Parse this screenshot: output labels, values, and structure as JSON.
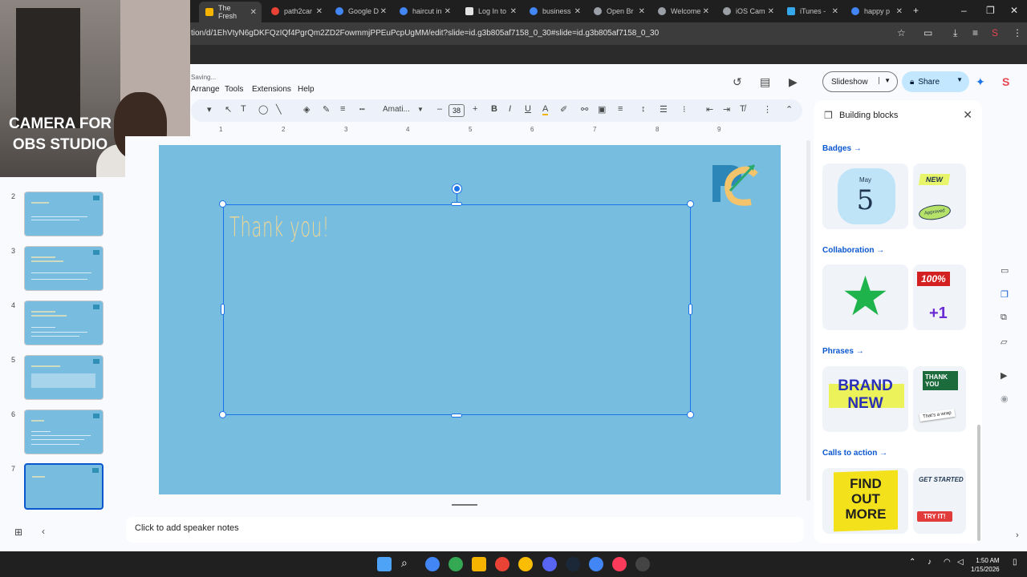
{
  "browser": {
    "tabs": [
      {
        "label": "The Fresh",
        "color": "#f4b400",
        "active": true
      },
      {
        "label": "path2car",
        "color": "#ea4335"
      },
      {
        "label": "Google D",
        "color": "#4285f4"
      },
      {
        "label": "haircut in",
        "color": "#4285f4"
      },
      {
        "label": "Log In to",
        "color": "#e3e3e3"
      },
      {
        "label": "business",
        "color": "#4285f4"
      },
      {
        "label": "Open Br",
        "color": "#9aa0a6"
      },
      {
        "label": "Welcome",
        "color": "#9aa0a6"
      },
      {
        "label": "iOS Cam",
        "color": "#9aa0a6"
      },
      {
        "label": "iTunes -",
        "color": "#34a8eb"
      },
      {
        "label": "happy p",
        "color": "#4285f4"
      }
    ],
    "url": "tion/d/1EhVtyN6gDKFQzIQf4PgrQm2ZD2FowmmjPPEuPcpUgMM/edit?slide=id.g3b805af7158_0_30#slide=id.g3b805af7158_0_30"
  },
  "app": {
    "status": "Saving...",
    "menus": [
      "Arrange",
      "Tools",
      "Extensions",
      "Help"
    ],
    "slideshow_label": "Slideshow",
    "share_label": "Share"
  },
  "toolbar": {
    "font_name": "Amati...",
    "font_size": "38",
    "bold": "B",
    "italic": "I",
    "underline": "U"
  },
  "ruler": [
    "1",
    "2",
    "3",
    "4",
    "5",
    "6",
    "7",
    "8",
    "9"
  ],
  "webcam": {
    "label": "CAMERA FOR OBS STUDIO"
  },
  "filmstrip": {
    "slides": [
      "2",
      "3",
      "4",
      "5",
      "6",
      "7"
    ],
    "selected": "7"
  },
  "slide": {
    "title": "Thank you!",
    "background": "#77bddf",
    "title_color": "#f1d793"
  },
  "notes": {
    "placeholder": "Click to add speaker notes"
  },
  "panel": {
    "title": "Building blocks",
    "sections": [
      {
        "label": "Badges →",
        "items": [
          "May",
          "5",
          "NEW",
          "Approved"
        ]
      },
      {
        "label": "Collaboration →",
        "items": [
          "100%",
          "+1"
        ]
      },
      {
        "label": "Phrases →",
        "items": [
          "BRAND NEW",
          "THANK YOU",
          "That's a wrap"
        ]
      },
      {
        "label": "Calls to action →",
        "items": [
          "FIND OUT MORE",
          "GET STARTED",
          "TRY IT!"
        ]
      }
    ]
  },
  "taskbar": {
    "time": "1:50 AM",
    "date": "1/15/2026"
  }
}
